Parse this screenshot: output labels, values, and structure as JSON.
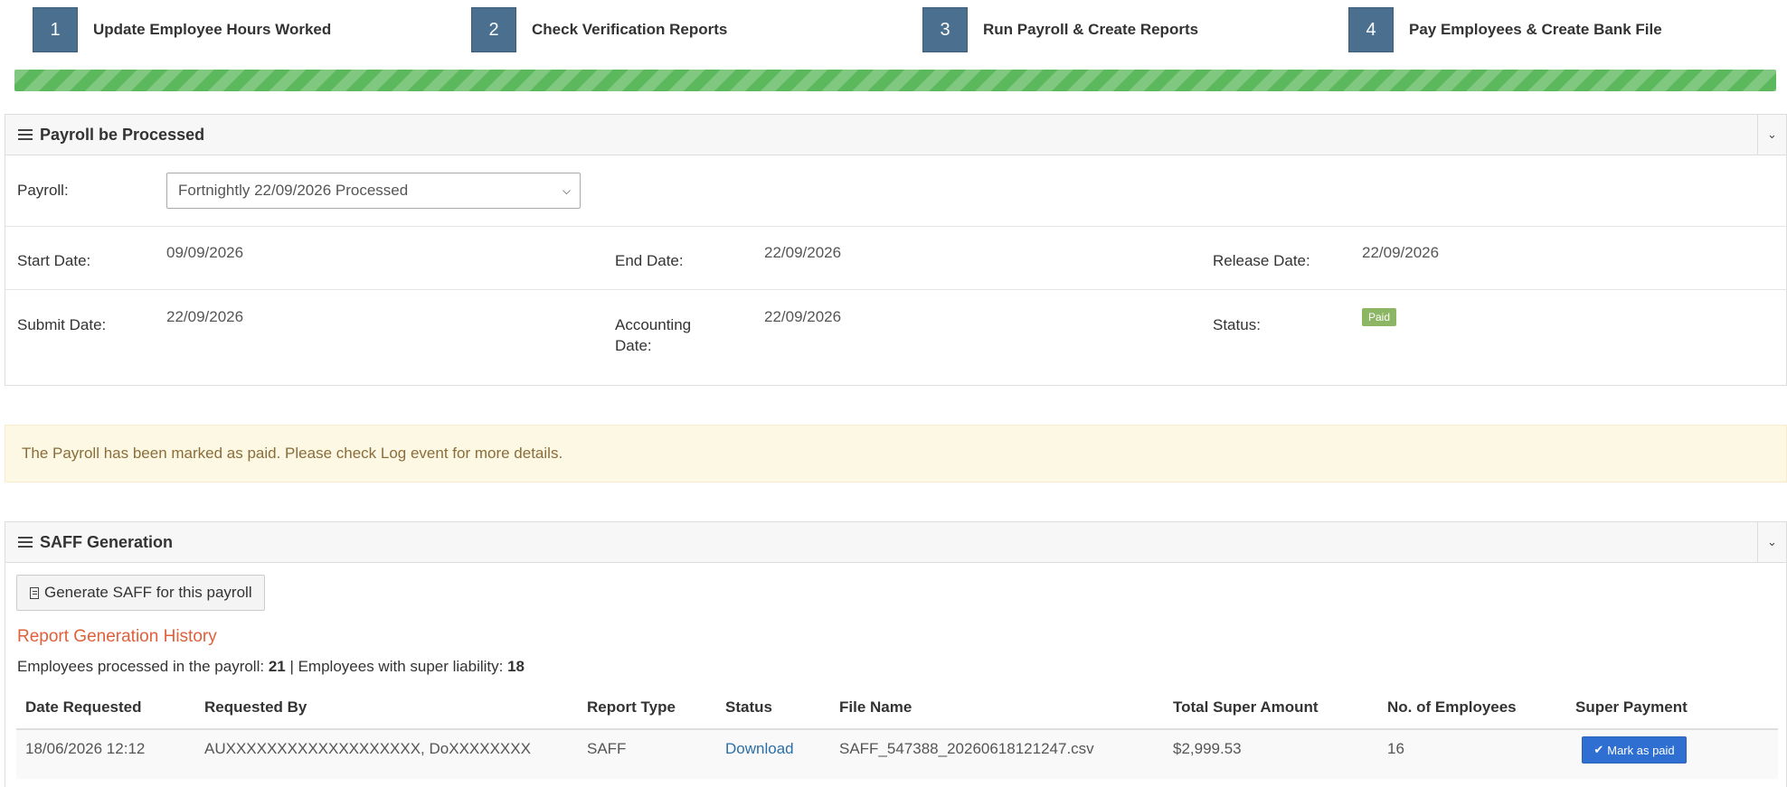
{
  "steps": [
    {
      "num": "1",
      "label": "Update Employee Hours Worked"
    },
    {
      "num": "2",
      "label": "Check Verification Reports"
    },
    {
      "num": "3",
      "label": "Run Payroll & Create Reports"
    },
    {
      "num": "4",
      "label": "Pay Employees & Create Bank File"
    }
  ],
  "progress": {
    "percent": 100,
    "color": "#5cb85c"
  },
  "payroll_panel": {
    "title": "Payroll be Processed",
    "payroll_label": "Payroll:",
    "payroll_selected": "Fortnightly 22/09/2026 Processed",
    "start_date_label": "Start Date:",
    "start_date": "09/09/2026",
    "end_date_label": "End Date:",
    "end_date": "22/09/2026",
    "release_date_label": "Release Date:",
    "release_date": "22/09/2026",
    "submit_date_label": "Submit Date:",
    "submit_date": "22/09/2026",
    "accounting_date_label_1": "Accounting",
    "accounting_date_label_2": "Date:",
    "accounting_date": "22/09/2026",
    "status_label": "Status:",
    "status": "Paid"
  },
  "alert": {
    "text": "The Payroll has been marked as paid. Please check Log event for more details."
  },
  "saff_panel": {
    "title": "SAFF Generation",
    "generate_button": "Generate SAFF for this payroll",
    "history_title": "Report Generation History",
    "summary_prefix": "Employees processed in the payroll: ",
    "employees_processed": "21",
    "summary_mid": " | Employees with super liability: ",
    "employees_with_super": "18",
    "columns": [
      "Date Requested",
      "Requested By",
      "Report Type",
      "Status",
      "File Name",
      "Total Super Amount",
      "No. of Employees",
      "Super Payment"
    ],
    "rows": [
      {
        "date_requested": "18/06/2026 12:12",
        "requested_by": "AUXXXXXXXXXXXXXXXXXXX, DoXXXXXXXX",
        "report_type": "SAFF",
        "status": "Download",
        "file_name": "SAFF_547388_20260618121247.csv",
        "total_super": "$2,999.53",
        "num_employees": "16",
        "super_payment": "Mark as paid"
      }
    ]
  },
  "colors": {
    "accent": "#4a6f8f",
    "badge_paid": "#8cb663",
    "history_title": "#e0603a",
    "link": "#2a6fa8",
    "button_primary": "#2f6fd1"
  }
}
